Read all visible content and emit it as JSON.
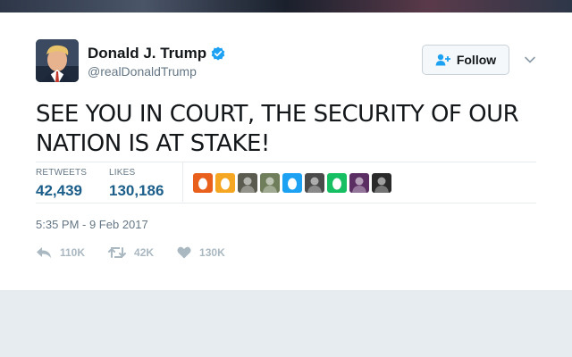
{
  "tweet": {
    "author_name": "Donald J. Trump",
    "handle": "@realDonaldTrump",
    "text": "SEE YOU IN COURT, THE SECURITY OF OUR NATION IS AT STAKE!",
    "timestamp": "5:35 PM - 9 Feb 2017",
    "verified": true
  },
  "follow_button": {
    "label": "Follow"
  },
  "stats": {
    "retweets_label": "RETWEETS",
    "retweets_value": "42,439",
    "likes_label": "LIKES",
    "likes_value": "130,186"
  },
  "actions": {
    "reply_count": "110K",
    "retweet_count": "42K",
    "like_count": "130K"
  },
  "likers": [
    {
      "kind": "egg",
      "color": "#e8601c"
    },
    {
      "kind": "egg",
      "color": "#f5a623"
    },
    {
      "kind": "photo",
      "color": "#5b5b4f"
    },
    {
      "kind": "photo",
      "color": "#6f7d5a"
    },
    {
      "kind": "egg",
      "color": "#1da1f2"
    },
    {
      "kind": "photo",
      "color": "#4a4a4a"
    },
    {
      "kind": "egg",
      "color": "#17bf63"
    },
    {
      "kind": "photo",
      "color": "#5a2d63"
    },
    {
      "kind": "photo",
      "color": "#2a2a2a"
    }
  ],
  "colors": {
    "accent": "#1da1f2",
    "stat_value": "#1b5e8a",
    "muted": "#657786",
    "action_icon": "#aab8c2"
  }
}
